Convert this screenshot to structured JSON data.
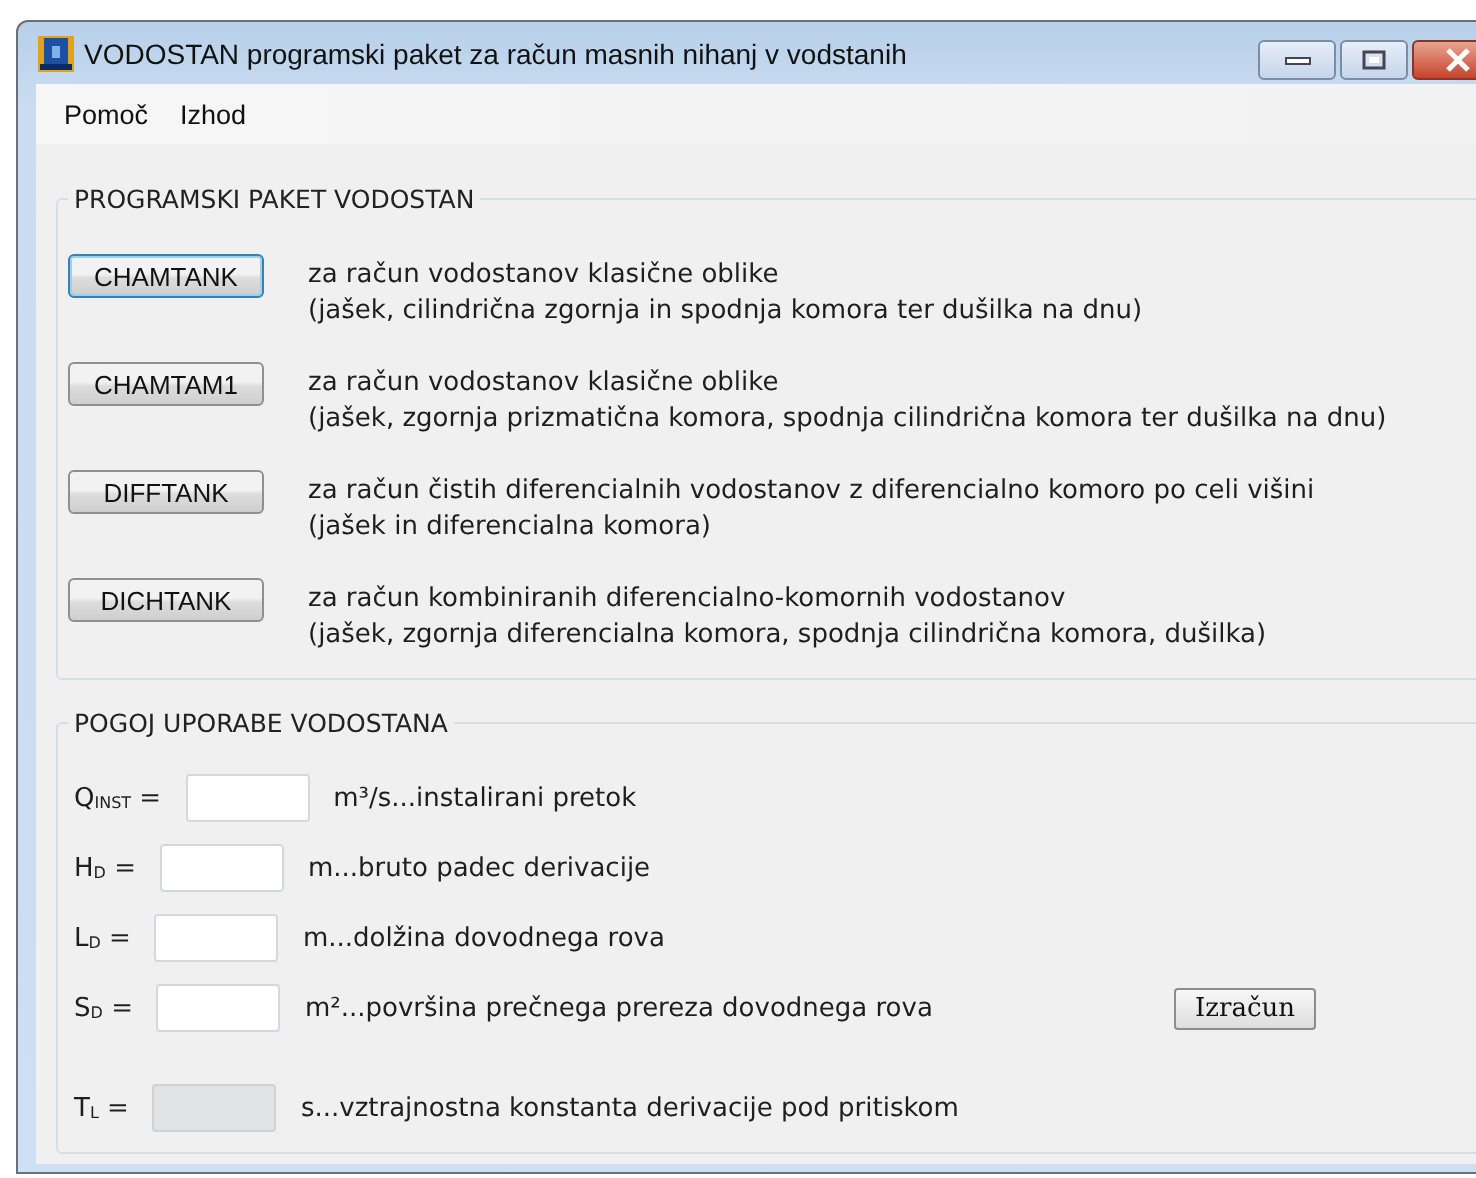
{
  "window": {
    "title": "VODOSTAN programski paket za račun masnih nihanj v vodstanih"
  },
  "menu": [
    "Pomoč",
    "Izhod"
  ],
  "programs": {
    "title": "PROGRAMSKI PAKET VODOSTAN",
    "items": [
      {
        "button": "CHAMTANK",
        "focused": true,
        "lines": [
          "za račun vodostanov klasične oblike",
          "(jašek, cilindrična zgornja in spodnja komora ter dušilka na dnu)"
        ]
      },
      {
        "button": "CHAMTAM1",
        "focused": false,
        "lines": [
          "za račun vodostanov klasične oblike",
          "(jašek, zgornja prizmatična komora, spodnja cilindrična komora ter dušilka na dnu)"
        ]
      },
      {
        "button": "DIFFTANK",
        "focused": false,
        "lines": [
          "za račun čistih diferencialnih vodostanov z diferencialno komoro po celi višini",
          "(jašek in diferencialna komora)"
        ]
      },
      {
        "button": "DICHTANK",
        "focused": false,
        "lines": [
          "za račun kombiniranih diferencialno-komornih vodostanov",
          "(jašek, zgornja diferencialna komora, spodnja cilindrična komora, dušilka)"
        ]
      }
    ]
  },
  "conditions": {
    "title": "POGOJ UPORABE VODOSTANA",
    "fields": [
      {
        "label": "Q$_{INST}$ =",
        "unit": "m³/s...instalirani pretok",
        "disabled": false
      },
      {
        "label": "H$_{D}$ =",
        "unit": "m...bruto padec derivacije",
        "disabled": false
      },
      {
        "label": "L$_{D}$ =",
        "unit": "m...dolžina dovodnega rova",
        "disabled": false
      },
      {
        "label": "S$_{D}$ =",
        "unit": "m²...površina prečnega prereza dovodnega rova",
        "disabled": false,
        "button": "Izračun"
      },
      {
        "label": "T$_{L}$ =",
        "unit": "s...vztrajnostna konstanta derivacije pod pritiskom",
        "disabled": true
      }
    ]
  }
}
